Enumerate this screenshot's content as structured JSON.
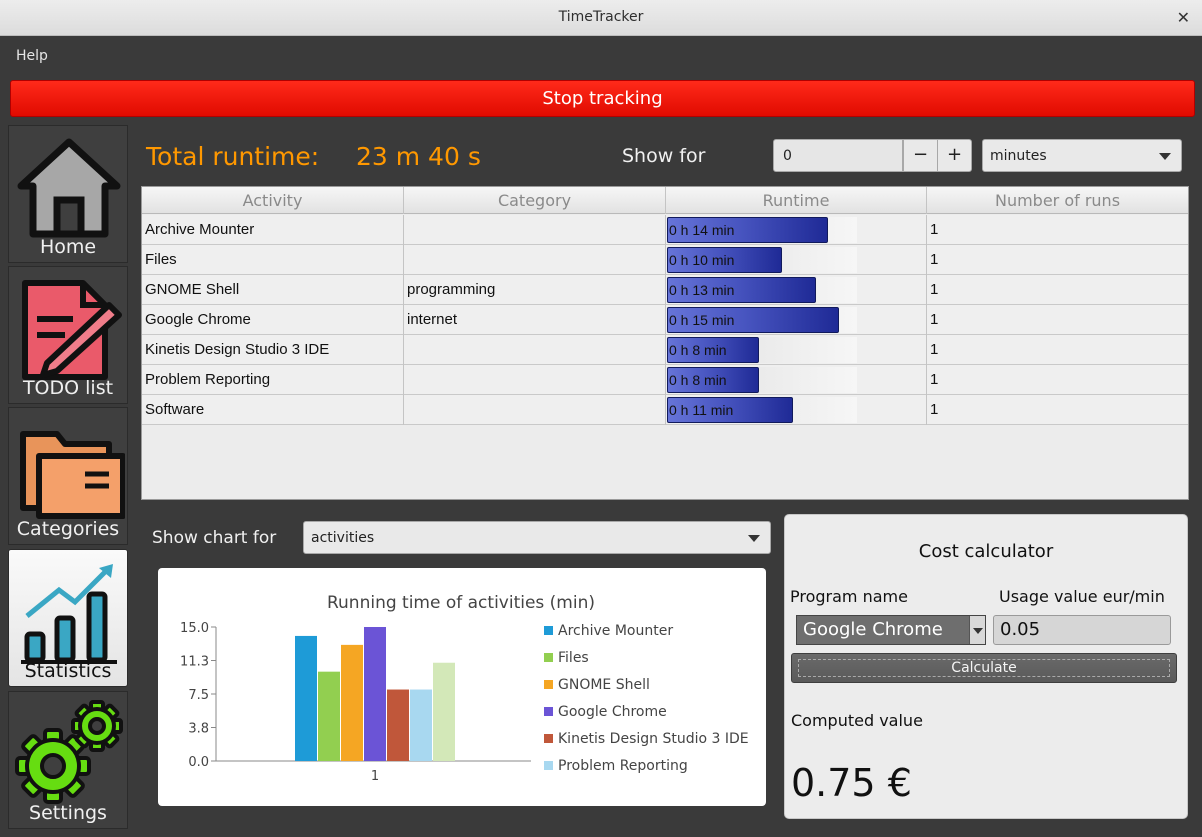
{
  "window": {
    "title": "TimeTracker",
    "close_glyph": "✕"
  },
  "menu": {
    "items": [
      "Help"
    ]
  },
  "stop_button": {
    "label": "Stop tracking"
  },
  "sidebar": {
    "items": [
      {
        "label": "Home",
        "icon": "home-icon"
      },
      {
        "label": "TODO list",
        "icon": "todo-document-icon"
      },
      {
        "label": "Categories",
        "icon": "folder-icon"
      },
      {
        "label": "Statistics",
        "icon": "statistics-chart-icon",
        "active": true
      },
      {
        "label": "Settings",
        "icon": "gears-icon"
      }
    ]
  },
  "summary": {
    "runtime_label": "Total runtime:",
    "runtime_value": "23 m 40 s",
    "show_for_label": "Show for",
    "show_for_value": "0",
    "minus": "−",
    "plus": "+",
    "unit_selected": "minutes"
  },
  "table": {
    "columns": [
      "Activity",
      "Category",
      "Runtime",
      "Number of runs"
    ],
    "rows": [
      {
        "activity": "Archive Mounter",
        "category": "",
        "runtime": "0 h 14 min",
        "minutes": 14,
        "runs": "1"
      },
      {
        "activity": "Files",
        "category": "",
        "runtime": "0 h 10 min",
        "minutes": 10,
        "runs": "1"
      },
      {
        "activity": "GNOME Shell",
        "category": "programming",
        "runtime": "0 h 13 min",
        "minutes": 13,
        "runs": "1"
      },
      {
        "activity": "Google Chrome",
        "category": "internet",
        "runtime": "0 h 15 min",
        "minutes": 15,
        "runs": "1"
      },
      {
        "activity": "Kinetis Design Studio 3 IDE",
        "category": "",
        "runtime": "0 h 8 min",
        "minutes": 8,
        "runs": "1"
      },
      {
        "activity": "Problem Reporting",
        "category": "",
        "runtime": "0 h 8 min",
        "minutes": 8,
        "runs": "1"
      },
      {
        "activity": "Software",
        "category": "",
        "runtime": "0 h 11 min",
        "minutes": 11,
        "runs": "1"
      }
    ]
  },
  "chart_controls": {
    "label": "Show chart for",
    "selected": "activities"
  },
  "chart_data": {
    "type": "bar",
    "title": "Running time of activities (min)",
    "categories": [
      "1"
    ],
    "ylim": [
      0,
      15
    ],
    "yticks": [
      "15.0",
      "11.3",
      "7.5",
      "3.8",
      "0.0"
    ],
    "grid": false,
    "legend_position": "right",
    "series": [
      {
        "name": "Archive Mounter",
        "values": [
          14
        ],
        "color": "#1e9bd7"
      },
      {
        "name": "Files",
        "values": [
          10
        ],
        "color": "#92cf50"
      },
      {
        "name": "GNOME Shell",
        "values": [
          13
        ],
        "color": "#f5a623"
      },
      {
        "name": "Google Chrome",
        "values": [
          15
        ],
        "color": "#6b54d6"
      },
      {
        "name": "Kinetis Design Studio 3 IDE",
        "values": [
          8
        ],
        "color": "#c0573a"
      },
      {
        "name": "Problem Reporting",
        "values": [
          8
        ],
        "color": "#a8d8f0"
      },
      {
        "values": [
          11
        ],
        "color": "#d3e8b8"
      }
    ]
  },
  "cost_calculator": {
    "title": "Cost calculator",
    "program_label": "Program name",
    "usage_label": "Usage value eur/min",
    "program_selected": "Google Chrome",
    "usage_value": "0.05",
    "button_label": "Calculate",
    "computed_label": "Computed value",
    "computed_value": "0.75 €"
  }
}
